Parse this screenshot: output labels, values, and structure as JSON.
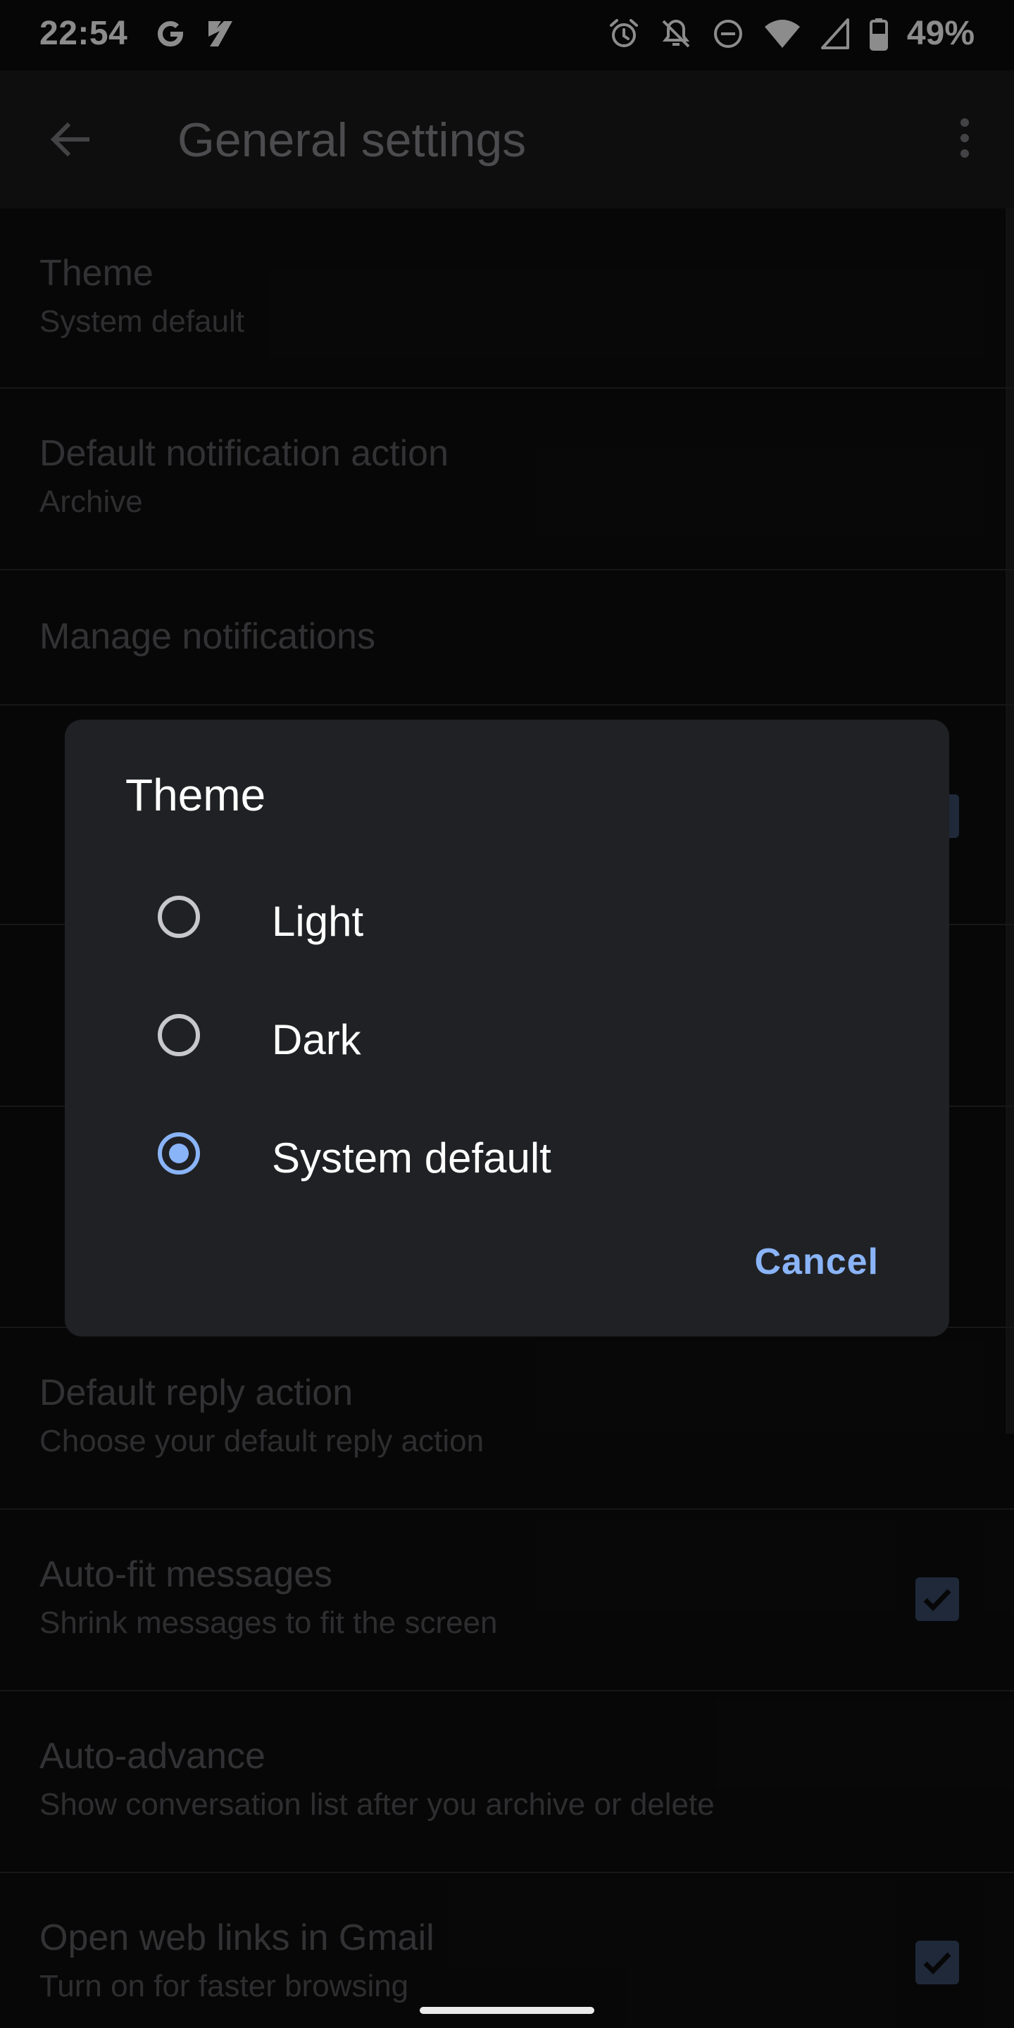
{
  "status_bar": {
    "time": "22:54",
    "battery": "49%"
  },
  "app_bar": {
    "title": "General settings"
  },
  "settings": {
    "theme": {
      "title": "Theme",
      "subtitle": "System default"
    },
    "notification_action": {
      "title": "Default notification action",
      "subtitle": "Archive"
    },
    "manage_notifications": {
      "title": "Manage notifications"
    },
    "reply_action": {
      "title": "Default reply action",
      "subtitle": "Choose your default reply action"
    },
    "auto_fit": {
      "title": "Auto-fit messages",
      "subtitle": "Shrink messages to fit the screen",
      "checked": true
    },
    "auto_advance": {
      "title": "Auto-advance",
      "subtitle": "Show conversation list after you archive or delete"
    },
    "open_links": {
      "title": "Open web links in Gmail",
      "subtitle": "Turn on for faster browsing",
      "checked": true
    }
  },
  "dialog": {
    "title": "Theme",
    "options": [
      {
        "label": "Light",
        "selected": false
      },
      {
        "label": "Dark",
        "selected": false
      },
      {
        "label": "System default",
        "selected": true
      }
    ],
    "cancel_label": "Cancel"
  },
  "colors": {
    "accent": "#8ab4f8",
    "dialog_bg": "#202124"
  }
}
